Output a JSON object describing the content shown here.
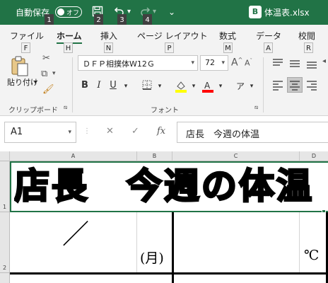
{
  "titlebar": {
    "autosave_label": "自動保存",
    "autosave_state": "オフ",
    "filename": "体温表.xlsx",
    "file_badge": "B",
    "more": "⌄",
    "keytips": [
      "1",
      "2",
      "3",
      "4"
    ]
  },
  "ribbon_tabs": [
    {
      "label": "ファイル",
      "keytip": "F"
    },
    {
      "label": "ホーム",
      "keytip": "H"
    },
    {
      "label": "挿入",
      "keytip": "N"
    },
    {
      "label": "ページ レイアウト",
      "keytip": "P"
    },
    {
      "label": "数式",
      "keytip": "M"
    },
    {
      "label": "データ",
      "keytip": "A"
    },
    {
      "label": "校閲",
      "keytip": "R"
    }
  ],
  "clipboard": {
    "paste_label": "貼り付け",
    "group_label": "クリップボード"
  },
  "font": {
    "name": "ＤＦＰ相撲体W12Ｇ",
    "size": "72",
    "group_label": "フォント",
    "bold": "B",
    "italic": "I",
    "underline": "U",
    "grow": "A",
    "shrink": "A",
    "phonetic": "ア",
    "highlight_color": "#ffff00",
    "font_color": "#ff0000"
  },
  "formula_bar": {
    "name_box": "A1",
    "cancel": "✕",
    "enter": "✓",
    "fx": "fx",
    "value": "店長　今週の体温"
  },
  "sheet": {
    "columns": [
      "A",
      "B",
      "C",
      "D"
    ],
    "rows": [
      "1",
      "2"
    ],
    "title": "店長　今週の体温",
    "slash": "／",
    "weekday": "(月)",
    "unit": "℃"
  },
  "colors": {
    "accent": "#217346",
    "ribbon_bg": "#f3f3f3",
    "header_bg": "#e6e6e6",
    "selection": "#217346"
  }
}
